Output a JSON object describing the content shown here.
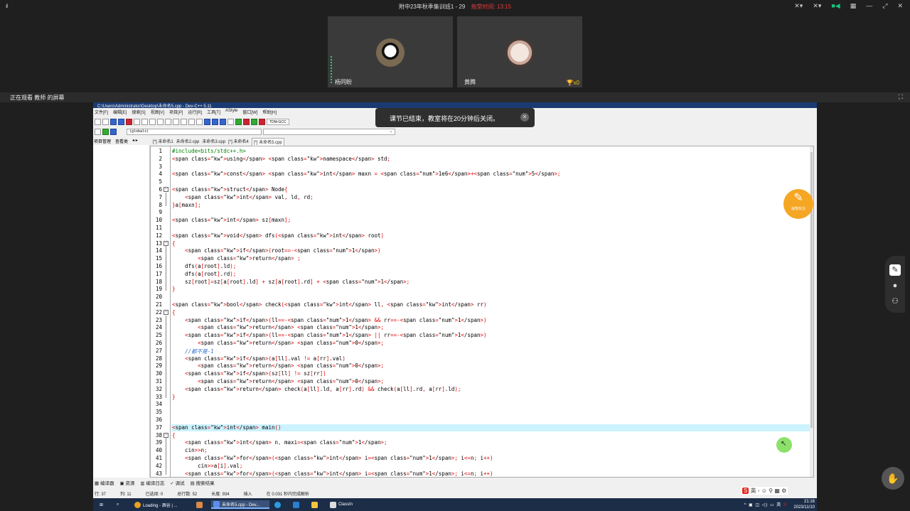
{
  "app": {
    "signal": "ıl",
    "class_title": "附中23年秋季集训班1 - 29",
    "timer_label": "拖堂时间: 13:15",
    "colors": {
      "accent_red": "#e23b3b",
      "accent_green": "#19c37d",
      "annotation_orange": "#f5a623",
      "taskbar": "#1c2d48"
    }
  },
  "participants": [
    {
      "name": "杨同盼",
      "avatar_icon": "panda-avatar"
    },
    {
      "name": "黄腾",
      "avatar_icon": "cat-avatar",
      "trophy": "x0"
    }
  ],
  "watching": {
    "label": "正在观看 教师 的屏幕"
  },
  "toast": {
    "message": "课节已结束，教室将在20分钟后关闭。"
  },
  "annotation": {
    "label": "画笔标注"
  },
  "devcpp": {
    "window_title": "C:\\Users\\Administrator\\Desktop\\未命名5.cpp - Dev-C++ 5.11",
    "menu": [
      "文件[F]",
      "编辑[E]",
      "搜索[S]",
      "视图[V]",
      "项目[P]",
      "运行[R]",
      "工具[T]",
      "AStyle",
      "窗口[W]",
      "帮助[H]"
    ],
    "compiler": "TDM-GCC",
    "scope": "(globals)",
    "left_tabs": [
      "项目管理",
      "查看类"
    ],
    "file_tabs": [
      {
        "label": "[*] 未命名1",
        "active": false
      },
      {
        "label": "未命名2.cpp",
        "active": false
      },
      {
        "label": "未命名3.cpp",
        "active": false
      },
      {
        "label": "[*] 未命名4",
        "active": false
      },
      {
        "label": "[*] 未命名5.cpp",
        "active": true
      }
    ],
    "bottom_tabs": [
      "编译器",
      "资源",
      "编译日志",
      "调试",
      "搜索结果"
    ],
    "status": {
      "row": "行: 37",
      "col": "列: 11",
      "selected": "已选择: 0",
      "total_lines": "总行数: 52",
      "length": "长度: 934",
      "mode": "插入",
      "parse": "在 0.031 秒内完成解析"
    },
    "code_lines": [
      "#include<bits/stdc++.h>",
      "using namespace std;",
      "",
      "const int maxn = 1e6+5;",
      "",
      "struct Node{",
      "    int val, ld, rd;",
      "}a[maxn];",
      "",
      "int sz[maxn];",
      "",
      "void dfs(int root)",
      "{",
      "    if(root==-1)",
      "        return ;",
      "    dfs(a[root].ld);",
      "    dfs(a[root].rd);",
      "    sz[root]=sz[a[root].ld] + sz[a[root].rd] + 1;",
      "}",
      "",
      "bool check(int ll, int rr)",
      "{",
      "    if(ll==-1 && rr==-1)",
      "        return 1;",
      "    if(ll==-1 || rr==-1)",
      "        return 0;",
      "    //都不是-1",
      "    if(a[ll].val != a[rr].val)",
      "        return 0;",
      "    if(sz[ll] != sz[rr])",
      "        return 0;",
      "    return check(a[ll].ld, a[rr].rd) && check(a[ll].rd, a[rr].ld);",
      "}",
      "",
      "",
      "",
      "int main()",
      "{",
      "    int n, maxi=1;",
      "    cin>>n;",
      "    for(int i=1; i<=n; i++)",
      "        cin>>a[i].val;",
      "    for(int i=1; i<=n; i++)"
    ],
    "current_line": 37
  },
  "taskbar": {
    "items": [
      {
        "label": "Loading - 酒谷 | ...",
        "icon": "chrome-icon",
        "active": false
      },
      {
        "label": "",
        "icon": "app-icon",
        "active": false
      },
      {
        "label": "未命名5.cpp - Dev...",
        "icon": "devcpp-icon",
        "active": true
      },
      {
        "label": "",
        "icon": "edge-icon",
        "active": false
      },
      {
        "label": "",
        "icon": "vscode-icon",
        "active": false
      },
      {
        "label": "",
        "icon": "folder-icon",
        "active": false
      },
      {
        "label": "ClassIn",
        "icon": "classin-icon",
        "active": false
      }
    ],
    "time": "21:16",
    "date": "2023/11/10",
    "ime": "英"
  }
}
